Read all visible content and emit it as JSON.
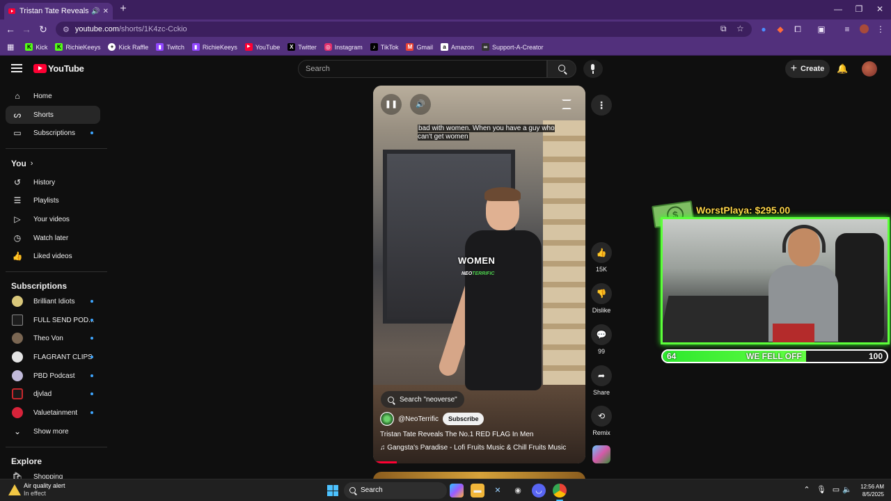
{
  "browser": {
    "tab_title": "Tristan Tate Reveals The No",
    "new_tab": "+",
    "url_host": "youtube.com",
    "url_path": "/shorts/1K4zc-Cckio",
    "window_controls": [
      "—",
      "❐",
      "✕"
    ],
    "bookmarks": [
      {
        "label": "Kick",
        "icon": "kick-icon",
        "color": "#53fc18"
      },
      {
        "label": "RichieKeeys",
        "icon": "kick-icon",
        "color": "#53fc18"
      },
      {
        "label": "Kick Raffle",
        "icon": "raffle-icon",
        "color": "#ffffff"
      },
      {
        "label": "Twitch",
        "icon": "twitch-icon",
        "color": "#9146ff"
      },
      {
        "label": "RichieKeeys",
        "icon": "twitch-icon",
        "color": "#9146ff"
      },
      {
        "label": "YouTube",
        "icon": "youtube-icon",
        "color": "#ff0033"
      },
      {
        "label": "Twitter",
        "icon": "x-icon",
        "color": "#000000"
      },
      {
        "label": "Instagram",
        "icon": "instagram-icon",
        "color": "#e1306c"
      },
      {
        "label": "TikTok",
        "icon": "tiktok-icon",
        "color": "#000000"
      },
      {
        "label": "Gmail",
        "icon": "gmail-icon",
        "color": "#ea4335"
      },
      {
        "label": "Amazon",
        "icon": "amazon-icon",
        "color": "#232f3e"
      },
      {
        "label": "Support-A-Creator",
        "icon": "epic-icon",
        "color": "#333333"
      }
    ]
  },
  "youtube": {
    "logo_text": "YouTube",
    "search_placeholder": "Search",
    "create_label": "Create",
    "sidebar": {
      "main": [
        {
          "label": "Home",
          "icon": "home-icon"
        },
        {
          "label": "Shorts",
          "icon": "shorts-icon",
          "active": true
        },
        {
          "label": "Subscriptions",
          "icon": "subscriptions-icon",
          "dot": true
        }
      ],
      "you_heading": "You",
      "you_items": [
        {
          "label": "History",
          "icon": "history-icon"
        },
        {
          "label": "Playlists",
          "icon": "playlists-icon"
        },
        {
          "label": "Your videos",
          "icon": "your-videos-icon"
        },
        {
          "label": "Watch later",
          "icon": "watch-later-icon"
        },
        {
          "label": "Liked videos",
          "icon": "liked-videos-icon"
        }
      ],
      "subs_heading": "Subscriptions",
      "subscriptions": [
        {
          "label": "Brilliant Idiots",
          "color": "#d9c77a"
        },
        {
          "label": "FULL SEND POD...",
          "color": "#1d1d1d"
        },
        {
          "label": "Theo Von",
          "color": "#7a6652"
        },
        {
          "label": "FLAGRANT CLIPS",
          "color": "#e4e4e4"
        },
        {
          "label": "PBD Podcast",
          "color": "#c0b9d9"
        },
        {
          "label": "djvlad",
          "color": "#c7282d"
        },
        {
          "label": "Valuetainment",
          "color": "#d7233a"
        }
      ],
      "show_more": "Show more",
      "explore_heading": "Explore",
      "explore_items": [
        {
          "label": "Shopping",
          "icon": "shopping-icon"
        }
      ]
    },
    "short": {
      "caption": "bad with women. When you have a guy who can't get women",
      "overlay_word": "WOMEN",
      "overlay_brand_a": "NEO",
      "overlay_brand_b": "TERRIFIC",
      "search_chip": "Search \"neoverse\"",
      "channel": "@NeoTerrific",
      "subscribe": "Subscribe",
      "title": "Tristan Tate Reveals The No.1 RED FLAG In Men",
      "music": "♫ Gangsta's Paradise - Lofi Fruits Music & Chill Fruits Music",
      "progress": 0.1
    },
    "actions": {
      "like_count": "15K",
      "dislike": "Dislike",
      "comments": "99",
      "share": "Share",
      "remix": "Remix"
    }
  },
  "stream_overlay": {
    "donation": "WorstPlaya: $295.00",
    "goal_current": "64",
    "goal_label": "WE FELL OFF",
    "goal_target": "100",
    "goal_fraction": 0.64,
    "accent": "#5cff3a"
  },
  "taskbar": {
    "weather_title": "Air quality alert",
    "weather_sub": "In effect",
    "search_label": "Search",
    "time": "12:56 AM",
    "date": "8/5/2025"
  }
}
